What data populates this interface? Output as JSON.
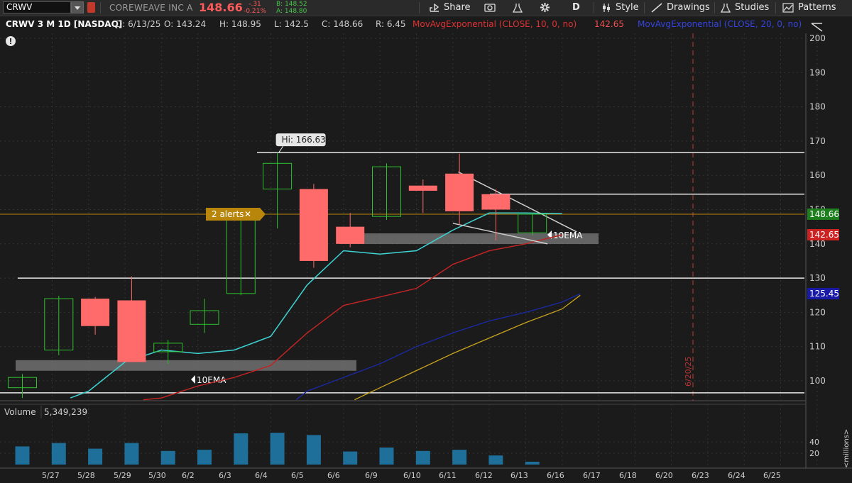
{
  "toolbar": {
    "symbol": "CRWV",
    "company": "COREWEAVE INC A",
    "last": "148.66",
    "change": "-.31",
    "change_pct": "-0.21%",
    "bid": "B: 148.52",
    "ask": "A: 148.80",
    "share": "Share",
    "period": "D",
    "style": "Style",
    "drawings": "Drawings",
    "studies": "Studies",
    "patterns": "Patterns"
  },
  "info": {
    "title": "CRWV 3 M 1D [NASDAQ]",
    "date": "D: 6/13/25",
    "open": "O: 143.24",
    "high": "H: 148.95",
    "low": "L: 142.5",
    "close": "C: 148.66",
    "range": "R: 6.45",
    "ema10_label": "MovAvgExponential (CLOSE, 10, 0, no)",
    "ema10_value": "142.65",
    "ema20_label": "MovAvgExponential (CLOSE, 20, 0, no)",
    "ema20_value": "125.45"
  },
  "chart_data": {
    "type": "candlestick",
    "colors": {
      "up": "#2fc02f",
      "down": "#ff6b6b",
      "ema10": "#3fd3d3",
      "ema_red": "#c02424",
      "ema_blue": "#1a2aa8",
      "ema_gold": "#c7a31e",
      "volume": "#1e6f9a",
      "bg": "#1b1b1b",
      "grid": "#333333",
      "price_badge": "#1d7f1d",
      "ema10_badge": "#cc2222",
      "ema20_badge": "#1a1aa8",
      "alert": "#b8860b"
    },
    "categories": [
      "5/27",
      "5/28",
      "5/29",
      "5/30",
      "6/2",
      "6/3",
      "6/4",
      "6/5",
      "6/6",
      "6/9",
      "6/10",
      "6/11",
      "6/12",
      "6/13"
    ],
    "future_dates": [
      "6/16",
      "6/17",
      "6/18",
      "6/20",
      "6/23",
      "6/24",
      "6/25"
    ],
    "candles": [
      {
        "d": "5/23",
        "o": 98,
        "h": 102,
        "l": 95,
        "c": 101,
        "up": true
      },
      {
        "d": "5/27",
        "o": 109,
        "h": 124.8,
        "l": 107.5,
        "c": 124,
        "up": true
      },
      {
        "d": "5/28",
        "o": 124,
        "h": 124.5,
        "l": 113.5,
        "c": 116,
        "up": false
      },
      {
        "d": "5/29",
        "o": 123.5,
        "h": 130.5,
        "l": 105.5,
        "c": 105.5,
        "up": false
      },
      {
        "d": "5/30",
        "o": 108.5,
        "h": 112,
        "l": 105,
        "c": 111,
        "up": true
      },
      {
        "d": "6/2",
        "o": 116.5,
        "h": 124,
        "l": 114,
        "c": 120.5,
        "up": true
      },
      {
        "d": "6/3",
        "o": 125.5,
        "h": 150,
        "l": 125,
        "c": 149,
        "up": true
      },
      {
        "d": "6/4",
        "o": 156,
        "h": 166.63,
        "l": 144.5,
        "c": 163.5,
        "up": true
      },
      {
        "d": "6/5",
        "o": 156,
        "h": 157.5,
        "l": 133,
        "c": 135,
        "up": false
      },
      {
        "d": "6/6",
        "o": 145,
        "h": 149,
        "l": 139,
        "c": 140,
        "up": false
      },
      {
        "d": "6/9",
        "o": 148,
        "h": 163.5,
        "l": 147,
        "c": 162.5,
        "up": true
      },
      {
        "d": "6/10",
        "o": 157,
        "h": 158.8,
        "l": 149,
        "c": 155.5,
        "up": false
      },
      {
        "d": "6/11",
        "o": 160.5,
        "h": 166.3,
        "l": 145.5,
        "c": 149.5,
        "up": false
      },
      {
        "d": "6/12",
        "o": 154.5,
        "h": 156,
        "l": 141,
        "c": 150,
        "up": false
      },
      {
        "d": "6/13",
        "o": 143.24,
        "h": 148.95,
        "l": 142.5,
        "c": 148.66,
        "up": true
      }
    ],
    "ema10": [
      [
        -0.5,
        95
      ],
      [
        0,
        97
      ],
      [
        1,
        105.5
      ],
      [
        2,
        109
      ],
      [
        3,
        108
      ],
      [
        4,
        109
      ],
      [
        5,
        113
      ],
      [
        6,
        128
      ],
      [
        7,
        138
      ],
      [
        8,
        137
      ],
      [
        9,
        138
      ],
      [
        10,
        144
      ],
      [
        11,
        149
      ],
      [
        12,
        149
      ],
      [
        13,
        148.8
      ]
    ],
    "ema_red": [
      [
        1.5,
        94.5
      ],
      [
        2,
        95
      ],
      [
        3,
        98.5
      ],
      [
        4,
        101
      ],
      [
        5,
        104.5
      ],
      [
        6,
        114
      ],
      [
        7,
        122
      ],
      [
        8,
        124.5
      ],
      [
        9,
        127
      ],
      [
        10,
        134
      ],
      [
        11,
        138
      ],
      [
        12,
        140
      ],
      [
        13,
        142.65
      ]
    ],
    "ema_blue": [
      [
        5.7,
        94.5
      ],
      [
        6,
        97
      ],
      [
        7,
        101
      ],
      [
        8,
        105
      ],
      [
        9,
        110
      ],
      [
        10,
        114
      ],
      [
        11,
        117.5
      ],
      [
        12,
        120
      ],
      [
        13,
        123
      ],
      [
        13.5,
        125.45
      ]
    ],
    "ema_gold": [
      [
        7.3,
        94.5
      ],
      [
        8,
        98
      ],
      [
        9,
        103
      ],
      [
        10,
        108
      ],
      [
        11,
        112.5
      ],
      [
        12,
        117
      ],
      [
        13,
        121
      ],
      [
        13.5,
        125
      ]
    ],
    "volume_millions": [
      32,
      38,
      28,
      38,
      24,
      26,
      55,
      56,
      52,
      23,
      30,
      24,
      26,
      16,
      5
    ],
    "hlines": [
      166.63,
      154.5,
      130,
      96.5
    ],
    "shaded_bands": [
      {
        "from_idx": -0.3,
        "to_idx": 8.8,
        "y": 104.5,
        "label": "10EMA"
      },
      {
        "from_idx": 8.7,
        "to_idx": 15.7,
        "y": 141.5,
        "label": "10EMA"
      }
    ],
    "trendlines": [
      [
        [
          11.15,
          161
        ],
        [
          14.4,
          143.5
        ]
      ],
      [
        [
          11.0,
          146
        ],
        [
          13.6,
          140
        ]
      ]
    ],
    "y_ticks": [
      100,
      110,
      120,
      130,
      140,
      150,
      160,
      170,
      180,
      190,
      200
    ],
    "volume_ticks": [
      20,
      40
    ],
    "volume_label": "Volume",
    "volume_value": "5,349,239",
    "volume_unit": "<millions>",
    "hi_label": "Hi: 166.63",
    "alert_label": "2 alerts",
    "price_badge": "148.66",
    "ema10_badge": "142.65",
    "ema20_badge": "125.45",
    "expiry_label": "6/20/25"
  }
}
